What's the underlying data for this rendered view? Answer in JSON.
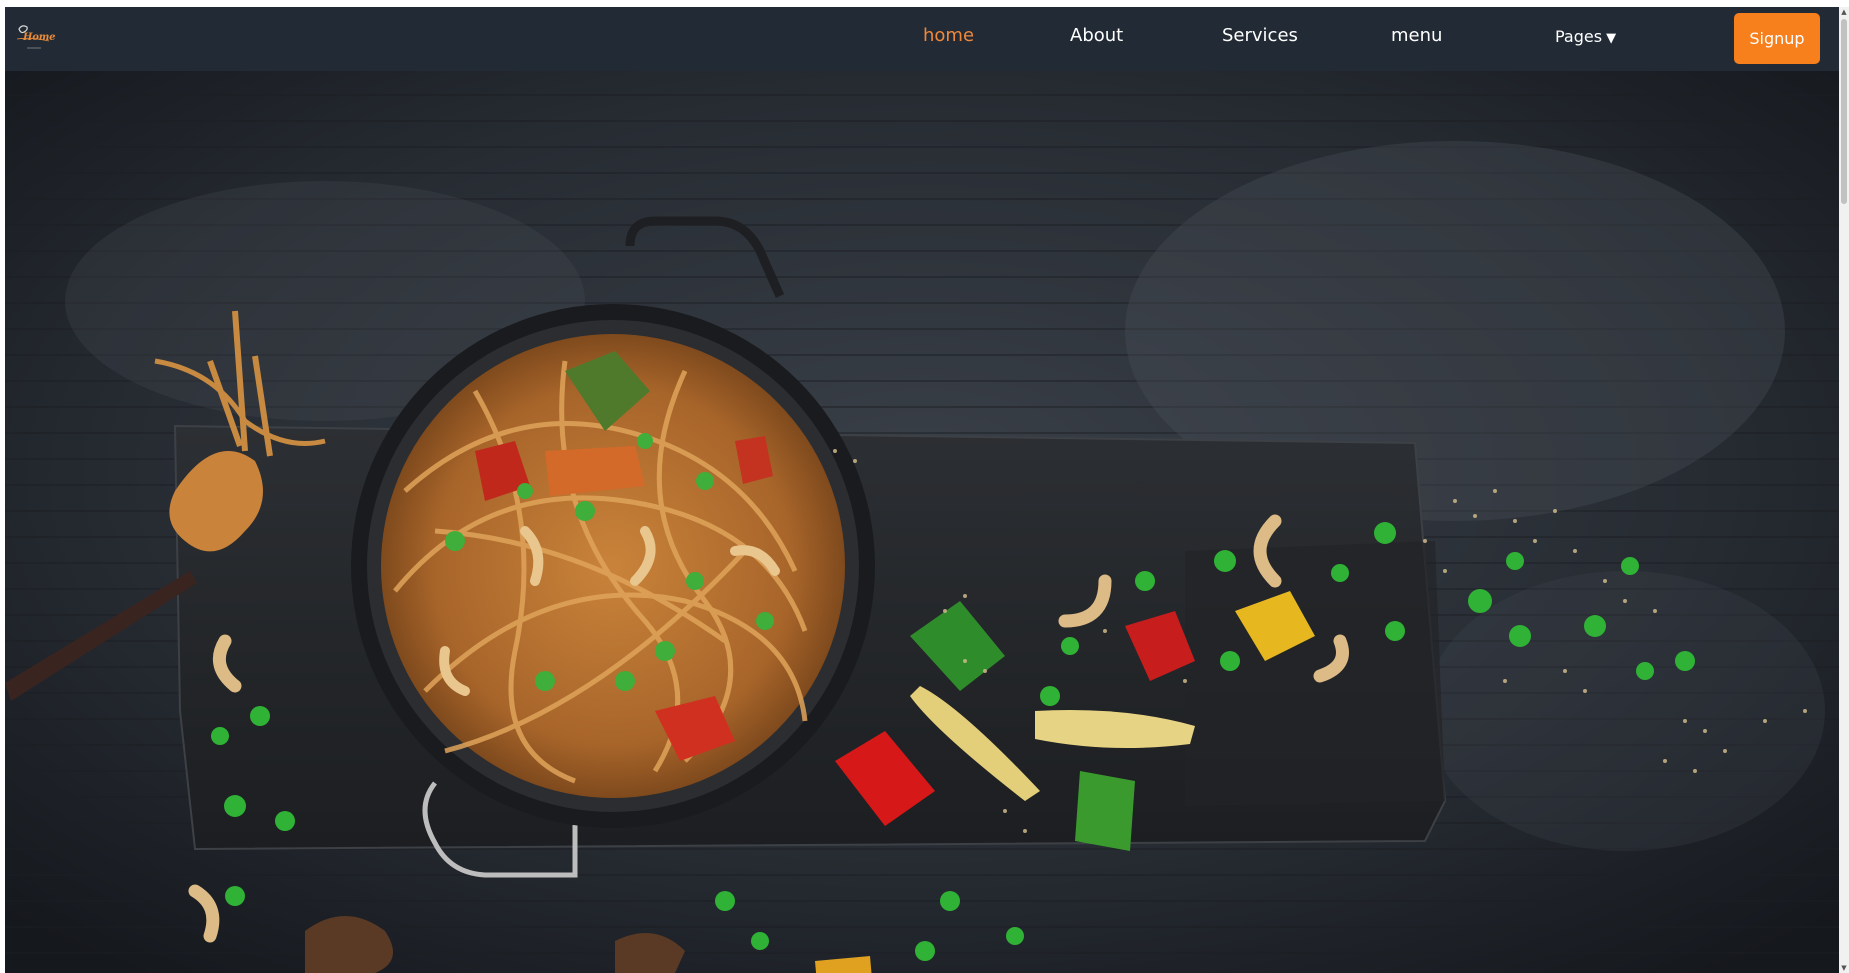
{
  "navbar": {
    "logo_text": "Home",
    "links": [
      {
        "label": "home",
        "active": true
      },
      {
        "label": "About",
        "active": false
      },
      {
        "label": "Services",
        "active": false
      },
      {
        "label": "menu",
        "active": false
      }
    ],
    "pages_label": "Pages",
    "pages_caret": "▼",
    "signup_label": "Signup"
  },
  "hero": {
    "image": "noodle-bowl-with-vegetables-on-dark-wooden-board"
  },
  "colors": {
    "navbar_bg": "#222b35",
    "accent": "#f77f1c",
    "active_link": "#f0883a",
    "link": "#ffffff"
  }
}
